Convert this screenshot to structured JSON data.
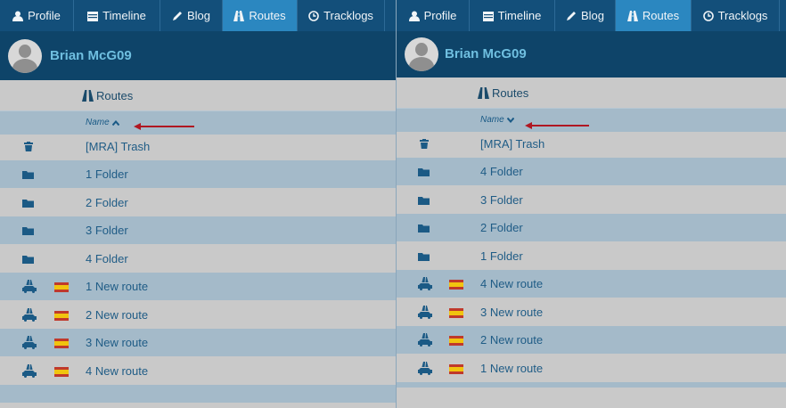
{
  "left": {
    "nav": [
      {
        "label": "Profile",
        "icon": "user-icon"
      },
      {
        "label": "Timeline",
        "icon": "calendar-icon"
      },
      {
        "label": "Blog",
        "icon": "pencil-icon"
      },
      {
        "label": "Routes",
        "icon": "road-icon",
        "active": true
      },
      {
        "label": "Tracklogs",
        "icon": "clock-icon"
      }
    ],
    "user_name": "Brian McG09",
    "breadcrumb": "Routes",
    "sort_label": "Name",
    "sort_direction": "ascending",
    "rows": [
      {
        "label": "[MRA] Trash",
        "icon": "trash-icon"
      },
      {
        "label": "1 Folder",
        "icon": "folder-icon"
      },
      {
        "label": "2 Folder",
        "icon": "folder-icon"
      },
      {
        "label": "3 Folder",
        "icon": "folder-icon"
      },
      {
        "label": "4 Folder",
        "icon": "folder-icon"
      },
      {
        "label": "1 New route",
        "icon": "route-car-icon",
        "flag": "spain-flag-icon"
      },
      {
        "label": "2 New route",
        "icon": "route-car-icon",
        "flag": "spain-flag-icon"
      },
      {
        "label": "3 New route",
        "icon": "route-car-icon",
        "flag": "spain-flag-icon"
      },
      {
        "label": "4 New route",
        "icon": "route-car-icon",
        "flag": "spain-flag-icon"
      }
    ]
  },
  "right": {
    "nav": [
      {
        "label": "Profile",
        "icon": "user-icon"
      },
      {
        "label": "Timeline",
        "icon": "calendar-icon"
      },
      {
        "label": "Blog",
        "icon": "pencil-icon"
      },
      {
        "label": "Routes",
        "icon": "road-icon",
        "active": true
      },
      {
        "label": "Tracklogs",
        "icon": "clock-icon"
      }
    ],
    "user_name": "Brian McG09",
    "breadcrumb": "Routes",
    "sort_label": "Name",
    "sort_direction": "descending",
    "rows": [
      {
        "label": "[MRA] Trash",
        "icon": "trash-icon"
      },
      {
        "label": "4 Folder",
        "icon": "folder-icon"
      },
      {
        "label": "3 Folder",
        "icon": "folder-icon"
      },
      {
        "label": "2 Folder",
        "icon": "folder-icon"
      },
      {
        "label": "1 Folder",
        "icon": "folder-icon"
      },
      {
        "label": "4 New route",
        "icon": "route-car-icon",
        "flag": "spain-flag-icon"
      },
      {
        "label": "3 New route",
        "icon": "route-car-icon",
        "flag": "spain-flag-icon"
      },
      {
        "label": "2 New route",
        "icon": "route-car-icon",
        "flag": "spain-flag-icon"
      },
      {
        "label": "1 New route",
        "icon": "route-car-icon",
        "flag": "spain-flag-icon"
      }
    ]
  },
  "colors": {
    "nav_bg": "#134f7a",
    "nav_active": "#2b87c0",
    "user_bar": "#0e4469",
    "user_name": "#6fbfe0",
    "row_alt": "#a4bac9",
    "row_text": "#1f5c86",
    "annotation_red": "#c4182a"
  }
}
